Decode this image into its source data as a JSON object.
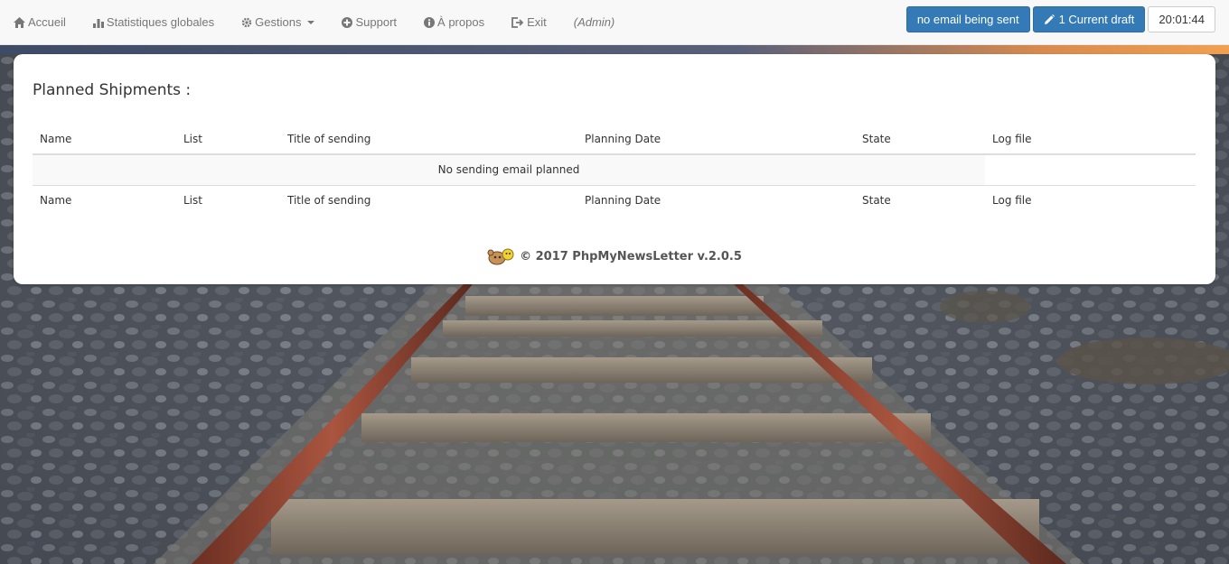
{
  "nav": {
    "items": [
      {
        "label": "Accueil",
        "icon": "home-icon"
      },
      {
        "label": "Statistiques globales",
        "icon": "bar-chart-icon"
      },
      {
        "label": "Gestions",
        "icon": "gear-icon"
      },
      {
        "label": "Support",
        "icon": "plus-circle-icon"
      },
      {
        "label": "À propos",
        "icon": "info-circle-icon"
      },
      {
        "label": "Exit",
        "icon": "log-out-icon"
      }
    ],
    "admin": "(Admin)"
  },
  "status": {
    "email_button": "no email being sent",
    "draft_button": "1 Current draft",
    "clock": "20:01:44"
  },
  "panel": {
    "title": "Planned Shipments :",
    "columns": [
      "Name",
      "List",
      "Title of sending",
      "Planning Date",
      "State",
      "Log file"
    ],
    "empty_message": "No sending email planned",
    "footer": "© 2017 PhpMyNewsLetter v.2.0.5"
  },
  "colors": {
    "primary": "#337ab7",
    "navbar_bg": "#f8f8f8",
    "nav_text": "#777777"
  }
}
